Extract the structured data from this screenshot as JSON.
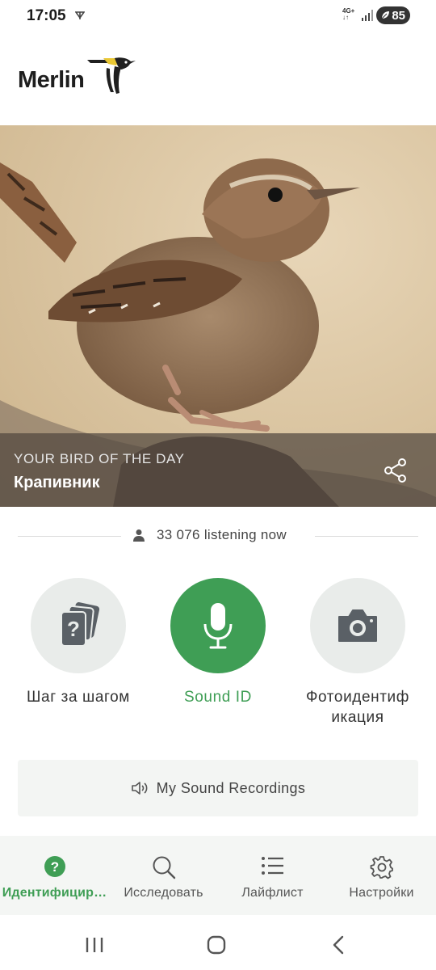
{
  "status": {
    "time": "17:05",
    "network": "4G+",
    "battery": "85"
  },
  "header": {
    "logo_text": "Merlin"
  },
  "hero": {
    "label": "YOUR BIRD OF THE DAY",
    "bird_name": "Крапивник"
  },
  "listening": {
    "count_text": "33 076 listening now"
  },
  "actions": [
    {
      "label": "Шаг за шагом",
      "icon": "question-cards-icon"
    },
    {
      "label": "Sound ID",
      "icon": "microphone-icon"
    },
    {
      "label": "Фотоидентиф икация",
      "icon": "camera-icon"
    }
  ],
  "recordings": {
    "label": "My Sound Recordings"
  },
  "nav": [
    {
      "label": "Идентифицир…",
      "icon": "question-circle-icon",
      "active": true
    },
    {
      "label": "Исследовать",
      "icon": "search-icon"
    },
    {
      "label": "Лайфлист",
      "icon": "list-icon"
    },
    {
      "label": "Настройки",
      "icon": "gear-icon"
    }
  ],
  "colors": {
    "accent": "#3f9e55",
    "icon_gray": "#5a6066",
    "circle_bg": "#e9ecea"
  }
}
